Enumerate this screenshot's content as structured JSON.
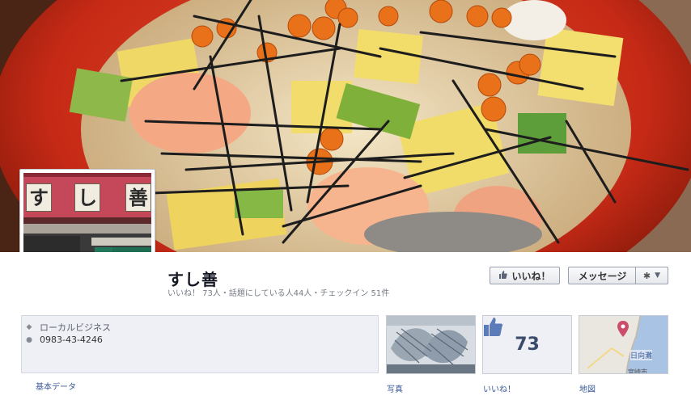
{
  "page": {
    "name": "すし善",
    "stats": "いいね！ 73人・話題にしている人44人・チェックイン 51件"
  },
  "profile_sign": [
    "す",
    "し",
    "善"
  ],
  "actions": {
    "like_label": "いいね！",
    "message_label": "メッセージ",
    "settings_icon": "gear-icon",
    "settings_caret": "▼"
  },
  "about": {
    "category": "ローカルビジネス",
    "phone": "0983-43-4246",
    "label": "基本データ"
  },
  "tiles": {
    "photos_label": "写真",
    "likes_label": "いいね！",
    "likes_count": "73",
    "map_label": "地図",
    "map_place": "日向灘",
    "map_city": "宮崎市"
  },
  "colors": {
    "facebook_blue": "#3b5998",
    "bowl_red": "#d0311b"
  }
}
